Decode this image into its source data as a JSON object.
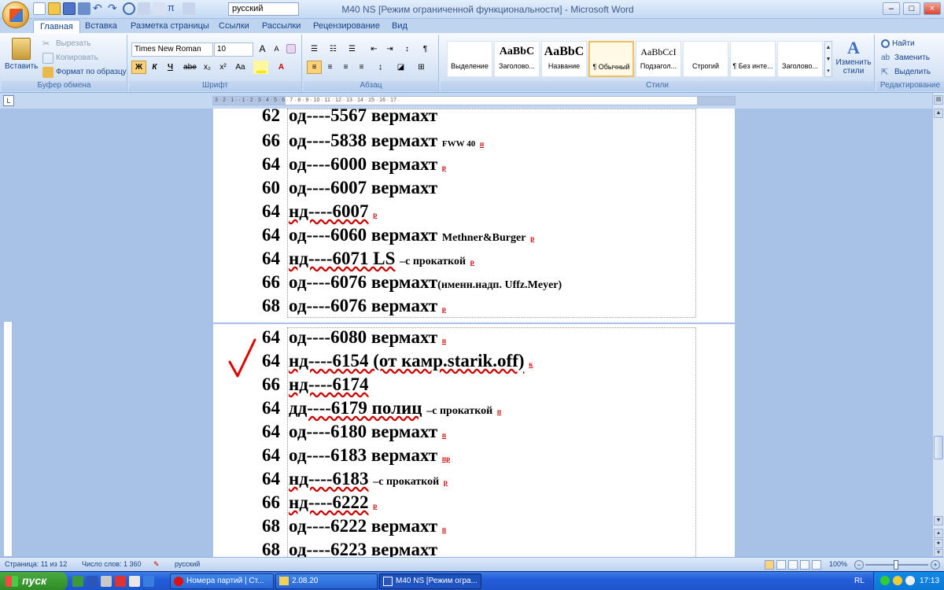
{
  "window": {
    "title": "M40 NS [Режим ограниченной функциональности] - Microsoft Word",
    "font_combo_value": "русский",
    "controls": [
      "–",
      "□",
      "×"
    ]
  },
  "tabs": [
    "Главная",
    "Вставка",
    "Разметка страницы",
    "Ссылки",
    "Рассылки",
    "Рецензирование",
    "Вид"
  ],
  "ribbon": {
    "clipboard": {
      "label": "Буфер обмена",
      "paste": "Вставить",
      "cut": "Вырезать",
      "copy": "Копировать",
      "format_painter": "Формат по образцу"
    },
    "font": {
      "label": "Шрифт",
      "name": "Times New Roman",
      "size": "10",
      "bold": "Ж",
      "italic": "К",
      "underline": "Ч",
      "strike": "abe",
      "subscript": "x₂",
      "superscript": "x²",
      "case": "Aa",
      "grow": "A",
      "shrink": "A"
    },
    "paragraph": {
      "label": "Абзац"
    },
    "styles": {
      "label": "Стили",
      "items": [
        {
          "sample": "",
          "name": "Выделение"
        },
        {
          "sample": "AaBbC",
          "name": "Заголово..."
        },
        {
          "sample": "AaBbC",
          "name": "Название"
        },
        {
          "sample": "",
          "name": "¶ Обычный"
        },
        {
          "sample": "AaBbCcI",
          "name": "Подзагол..."
        },
        {
          "sample": "",
          "name": "Строгий"
        },
        {
          "sample": "",
          "name": "¶ Без инте..."
        },
        {
          "sample": "",
          "name": "Заголово..."
        }
      ],
      "change_styles_line1": "Изменить",
      "change_styles_line2": "стили"
    },
    "editing": {
      "label": "Редактирование",
      "find": "Найти",
      "replace": "Заменить",
      "select": "Выделить"
    }
  },
  "ruler": {
    "text": "3 · 2 · 1 ·   · 1 · 2 · 3 · 4 · 5 · 6 · 7 · 8 · 9 · 10 · 11 · 12 · 13 · 14 · 15 · 16 · 17 ·",
    "toggle": "L"
  },
  "document": {
    "page1_lines": [
      {
        "num": "62",
        "body": "од----5567 вермахт",
        "extra": "",
        "mark": ""
      },
      {
        "num": "66",
        "body": "од----5838 вермахт",
        "extra": "FWW 40",
        "mark": "п"
      },
      {
        "num": "64",
        "body": "од----6000 вермахт",
        "extra": "",
        "mark": "р"
      },
      {
        "num": "60",
        "body": "од----6007 вермахт",
        "extra": "",
        "mark": ""
      },
      {
        "num": "64",
        "body": "нд----6007",
        "extra": "",
        "mark": "р"
      },
      {
        "num": "64",
        "body": "од----6060 вермахт",
        "extra": "Methner&Burger",
        "mark": "р"
      },
      {
        "num": "64",
        "body": "нд----6071 LS",
        "extra": "–с прокаткой",
        "mark": "р"
      },
      {
        "num": "66",
        "body": "од----6076 вермахт",
        "extra": "(именн.надп. Uffz.Meyer)",
        "mark": ""
      },
      {
        "num": "68",
        "body": "од----6076 вермахт",
        "extra": "",
        "mark": "р"
      }
    ],
    "page2_lines": [
      {
        "num": "64",
        "body": "од----6080 вермахт",
        "extra": "",
        "mark": "п"
      },
      {
        "num": "64",
        "body": "нд----6154 (от камр.starik.off)",
        "extra": "",
        "mark": "к"
      },
      {
        "num": "66",
        "body": "нд----6174",
        "extra": "",
        "mark": ""
      },
      {
        "num": "64",
        "body": "дд----6179 полиц",
        "extra": "–с прокаткой",
        "mark": "п"
      },
      {
        "num": "64",
        "body": "од----6180 вермахт",
        "extra": "",
        "mark": "п"
      },
      {
        "num": "64",
        "body": "од----6183 вермахт",
        "extra": "",
        "mark": "пр"
      },
      {
        "num": "64",
        "body": "нд----6183",
        "extra": "–с прокаткой",
        "mark": "р"
      },
      {
        "num": "66",
        "body": "нд----6222",
        "extra": "",
        "mark": "р"
      },
      {
        "num": "68",
        "body": "од----6222 вермахт",
        "extra": "",
        "mark": "п"
      },
      {
        "num": "68",
        "body": "од----6223 вермахт",
        "extra": "",
        "mark": ""
      }
    ]
  },
  "status": {
    "page": "Страница: 11 из 12",
    "words": "Число слов: 1 360",
    "language": "русский",
    "zoom": "100%"
  },
  "taskbar": {
    "start": "пуск",
    "items": [
      "Номера партий | Ст...",
      "2.08.20",
      "M40 NS [Режим огра..."
    ],
    "lang": "RL",
    "time": "17:13"
  },
  "colors": {
    "ribbon_bg": "#dbe7f7",
    "doc_bg": "#a8c1e6",
    "taskbar": "#245edb",
    "check_mark": "#e00000"
  }
}
